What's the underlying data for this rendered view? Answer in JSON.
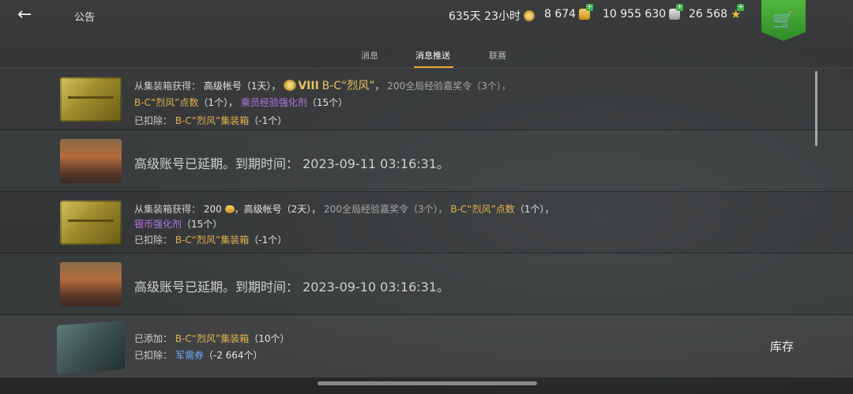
{
  "header": {
    "back_icon": "arrow-left-icon",
    "title": "公告",
    "premium_time": "635天 23小时",
    "gold": "8 674",
    "silver": "10 955 630",
    "free_xp": "26 568"
  },
  "tabs": [
    {
      "label": "消息"
    },
    {
      "label": "消息推送"
    },
    {
      "label": "联赛"
    }
  ],
  "messages": [
    {
      "l1_prefix": "从集装箱获得：",
      "l1_a": "高级帐号（1天），",
      "l1_tier": "VIII",
      "l1_tank": "B-C“烈风”",
      "l1_b": "，",
      "l1_c": "200全局经验嘉奖令（3个），",
      "l2_a": "B-C“烈风”点数",
      "l2_b": "（1个），",
      "l2_c": "乘员经验强化剂",
      "l2_d": "（15个）",
      "l3_a": "已扣除：",
      "l3_b": "B-C“烈风”集装箱",
      "l3_c": "（-1个）"
    },
    {
      "text": "高级账号已延期。到期时间： 2023-09-11 03:16:31。"
    },
    {
      "l1_prefix": "从集装箱获得：",
      "l1_a": "200",
      "l1_b": "，高级帐号（2天），",
      "l1_c": "200全局经验嘉奖令（3个），",
      "l1_d": "B-C“烈风”点数",
      "l1_e": "（1个），",
      "l2_a": "银币强化剂",
      "l2_b": "（15个）",
      "l3_a": "已扣除：",
      "l3_b": "B-C“烈风”集装箱",
      "l3_c": "（-1个）"
    },
    {
      "text": "高级账号已延期。到期时间： 2023-09-10 03:16:31。"
    },
    {
      "l1_a": "已添加：",
      "l1_b": "B-C“烈风”集装箱",
      "l1_c": "（10个）",
      "l2_a": "已扣除：",
      "l2_b": "军需券",
      "l2_c": "（-2 664个）",
      "action": "库存"
    }
  ],
  "colors": {
    "accent_tab": "#f0a531",
    "cart_green": "#3fa636",
    "gold_text": "#e2b24e",
    "purple_text": "#b676e8",
    "blue_text": "#6fa7ff"
  }
}
